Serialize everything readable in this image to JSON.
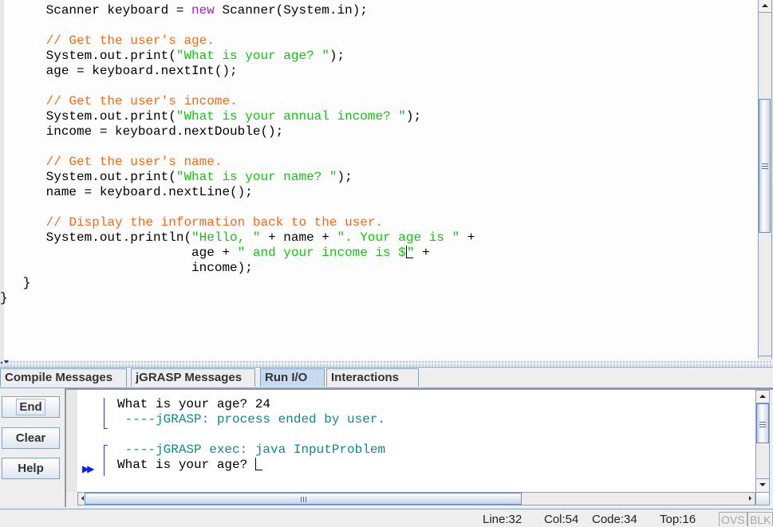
{
  "editor": {
    "lines": [
      [
        {
          "t": "      Scanner keyboard = "
        },
        {
          "t": "new",
          "c": "kw"
        },
        {
          "t": " Scanner(System.in);"
        }
      ],
      [],
      [
        {
          "t": "      // Get the user's age.",
          "c": "cm"
        }
      ],
      [
        {
          "t": "      System.out.print("
        },
        {
          "t": "\"What is your age? \"",
          "c": "st"
        },
        {
          "t": ");"
        }
      ],
      [
        {
          "t": "      age = keyboard.nextInt();"
        }
      ],
      [],
      [
        {
          "t": "      // Get the user's income.",
          "c": "cm"
        }
      ],
      [
        {
          "t": "      System.out.print("
        },
        {
          "t": "\"What is your annual income? \"",
          "c": "st"
        },
        {
          "t": ");"
        }
      ],
      [
        {
          "t": "      income = keyboard.nextDouble();"
        }
      ],
      [],
      [
        {
          "t": "      // Get the user's name.",
          "c": "cm"
        }
      ],
      [
        {
          "t": "      System.out.print("
        },
        {
          "t": "\"What is your name? \"",
          "c": "st"
        },
        {
          "t": ");"
        }
      ],
      [
        {
          "t": "      name = keyboard.nextLine();"
        }
      ],
      [],
      [
        {
          "t": "      // Display the information back to the user.",
          "c": "cm"
        }
      ],
      [
        {
          "t": "      System.out.println("
        },
        {
          "t": "\"Hello, \"",
          "c": "st"
        },
        {
          "t": " + name + "
        },
        {
          "t": "\". Your age is \"",
          "c": "st"
        },
        {
          "t": " +"
        }
      ],
      [
        {
          "t": "                         age + "
        },
        {
          "t": "\" and your income is $",
          "c": "st"
        },
        {
          "caret": true
        },
        {
          "t": "\"",
          "c": "st"
        },
        {
          "t": " +"
        }
      ],
      [
        {
          "t": "                         income);"
        }
      ],
      [
        {
          "t": "   }"
        }
      ],
      [
        {
          "t": "}"
        }
      ]
    ]
  },
  "tabs": [
    {
      "label": "Compile Messages",
      "active": false
    },
    {
      "label": "jGRASP Messages",
      "active": false
    },
    {
      "label": "Run I/O",
      "active": true
    },
    {
      "label": "Interactions",
      "active": false
    }
  ],
  "buttons": {
    "end": "End",
    "clear": "Clear",
    "help": "Help"
  },
  "run_io": {
    "lines": [
      {
        "text": "What is your age? 24",
        "kind": "output"
      },
      {
        "text": " ----jGRASP: process ended by user.",
        "kind": "system"
      },
      {
        "text": "",
        "kind": "blank"
      },
      {
        "text": " ----jGRASP exec: java InputProblem",
        "kind": "system"
      },
      {
        "text": "What is your age? ",
        "kind": "output"
      }
    ],
    "marker": "▶▶"
  },
  "status": {
    "line": "Line:32",
    "col": "Col:54",
    "code": "Code:34",
    "top": "Top:16",
    "ovs": "OVS",
    "blk": "BLK"
  },
  "colors": {
    "keyword": "#a020c8",
    "comment": "#f06a1a",
    "string": "#18c018",
    "system_msg": "#108888",
    "active_tab": "#c8daf0"
  }
}
